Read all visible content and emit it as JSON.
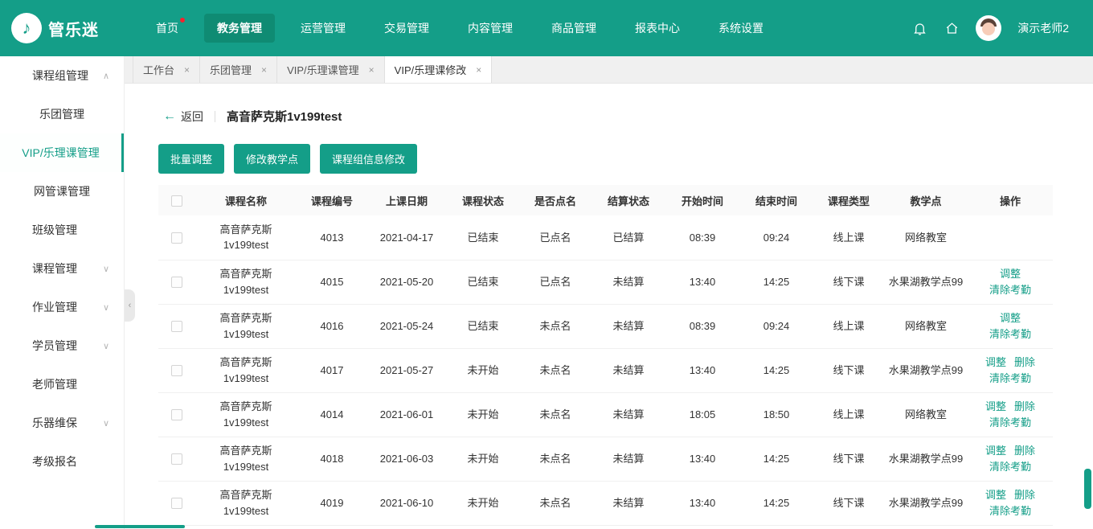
{
  "colors": {
    "primary": "#149e88",
    "primary_dark": "#0f8b73",
    "badge": "#f5222d",
    "link": "#149e88"
  },
  "brand": {
    "name": "管乐迷"
  },
  "topnav": {
    "items": [
      {
        "label": "首页",
        "active": false,
        "badge": true
      },
      {
        "label": "教务管理",
        "active": true,
        "badge": false
      },
      {
        "label": "运营管理",
        "active": false,
        "badge": false
      },
      {
        "label": "交易管理",
        "active": false,
        "badge": false
      },
      {
        "label": "内容管理",
        "active": false,
        "badge": false
      },
      {
        "label": "商品管理",
        "active": false,
        "badge": false
      },
      {
        "label": "报表中心",
        "active": false,
        "badge": false
      },
      {
        "label": "系统设置",
        "active": false,
        "badge": false
      }
    ],
    "user": "演示老师2"
  },
  "sidebar": {
    "items": [
      {
        "label": "课程组管理",
        "expandable": true,
        "expanded": true,
        "children": [
          {
            "label": "乐团管理",
            "active": false
          },
          {
            "label": "VIP/乐理课管理",
            "active": true
          },
          {
            "label": "网管课管理",
            "active": false
          }
        ]
      },
      {
        "label": "班级管理",
        "expandable": false,
        "children": []
      },
      {
        "label": "课程管理",
        "expandable": true,
        "expanded": false,
        "children": []
      },
      {
        "label": "作业管理",
        "expandable": true,
        "expanded": false,
        "children": []
      },
      {
        "label": "学员管理",
        "expandable": true,
        "expanded": false,
        "children": []
      },
      {
        "label": "老师管理",
        "expandable": false,
        "children": []
      },
      {
        "label": "乐器维保",
        "expandable": true,
        "expanded": false,
        "children": []
      },
      {
        "label": "考级报名",
        "expandable": false,
        "children": []
      }
    ]
  },
  "tabs": [
    {
      "label": "工作台",
      "active": false
    },
    {
      "label": "乐团管理",
      "active": false
    },
    {
      "label": "VIP/乐理课管理",
      "active": false
    },
    {
      "label": "VIP/乐理课修改",
      "active": true
    }
  ],
  "page": {
    "back_label": "返回",
    "title": "高音萨克斯1v199test",
    "buttons": [
      "批量调整",
      "修改教学点",
      "课程组信息修改"
    ]
  },
  "table": {
    "headers": [
      "课程名称",
      "课程编号",
      "上课日期",
      "课程状态",
      "是否点名",
      "结算状态",
      "开始时间",
      "结束时间",
      "课程类型",
      "教学点",
      "操作"
    ],
    "rows": [
      {
        "name": "高音萨克斯1v199test",
        "id": "4013",
        "date": "2021-04-17",
        "status": "已结束",
        "rollcall": "已点名",
        "settle": "已结算",
        "start": "08:39",
        "end": "09:24",
        "type": "线上课",
        "location": "网络教室",
        "actions": []
      },
      {
        "name": "高音萨克斯1v199test",
        "id": "4015",
        "date": "2021-05-20",
        "status": "已结束",
        "rollcall": "已点名",
        "settle": "未结算",
        "start": "13:40",
        "end": "14:25",
        "type": "线下课",
        "location": "水果湖教学点99",
        "actions": [
          "调整",
          "清除考勤"
        ]
      },
      {
        "name": "高音萨克斯1v199test",
        "id": "4016",
        "date": "2021-05-24",
        "status": "已结束",
        "rollcall": "未点名",
        "settle": "未结算",
        "start": "08:39",
        "end": "09:24",
        "type": "线上课",
        "location": "网络教室",
        "actions": [
          "调整",
          "清除考勤"
        ]
      },
      {
        "name": "高音萨克斯1v199test",
        "id": "4017",
        "date": "2021-05-27",
        "status": "未开始",
        "rollcall": "未点名",
        "settle": "未结算",
        "start": "13:40",
        "end": "14:25",
        "type": "线下课",
        "location": "水果湖教学点99",
        "actions": [
          "调整",
          "删除",
          "清除考勤"
        ]
      },
      {
        "name": "高音萨克斯1v199test",
        "id": "4014",
        "date": "2021-06-01",
        "status": "未开始",
        "rollcall": "未点名",
        "settle": "未结算",
        "start": "18:05",
        "end": "18:50",
        "type": "线上课",
        "location": "网络教室",
        "actions": [
          "调整",
          "删除",
          "清除考勤"
        ]
      },
      {
        "name": "高音萨克斯1v199test",
        "id": "4018",
        "date": "2021-06-03",
        "status": "未开始",
        "rollcall": "未点名",
        "settle": "未结算",
        "start": "13:40",
        "end": "14:25",
        "type": "线下课",
        "location": "水果湖教学点99",
        "actions": [
          "调整",
          "删除",
          "清除考勤"
        ]
      },
      {
        "name": "高音萨克斯1v199test",
        "id": "4019",
        "date": "2021-06-10",
        "status": "未开始",
        "rollcall": "未点名",
        "settle": "未结算",
        "start": "13:40",
        "end": "14:25",
        "type": "线下课",
        "location": "水果湖教学点99",
        "actions": [
          "调整",
          "删除",
          "清除考勤"
        ]
      }
    ]
  }
}
